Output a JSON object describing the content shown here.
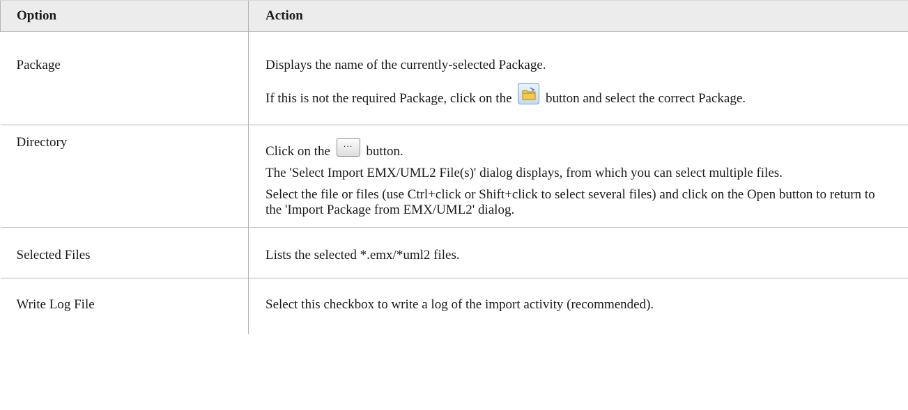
{
  "table": {
    "header": {
      "option": "Option",
      "action": "Action"
    },
    "rows": {
      "package": {
        "option": "Package",
        "p1": "Displays the name of the currently-selected Package.",
        "p2_before": "If this is not the required Package, click on the",
        "p2_after": "button and select the correct Package.",
        "icon": "folder-icon"
      },
      "directory": {
        "option": "Directory",
        "p1_before": "Click on the",
        "p1_after": "button.",
        "button_glyph": "...",
        "p2": "The 'Select Import EMX/UML2 File(s)' dialog displays, from which you can select multiple files.",
        "p3": "Select the file or files (use Ctrl+click or Shift+click to select several files) and click on the Open button to return to the 'Import Package from EMX/UML2' dialog."
      },
      "selected_files": {
        "option": "Selected Files",
        "p1": "Lists the selected *.emx/*uml2 files."
      },
      "write_log": {
        "option": "Write Log File",
        "p1": "Select this checkbox to write a log of the import activity (recommended)."
      }
    }
  },
  "colors": {
    "header_bg": "#ececec",
    "grid_line": "#b4b4b4",
    "folder_button_border": "#6f9cc9",
    "folder_color": "#f2c94c"
  }
}
